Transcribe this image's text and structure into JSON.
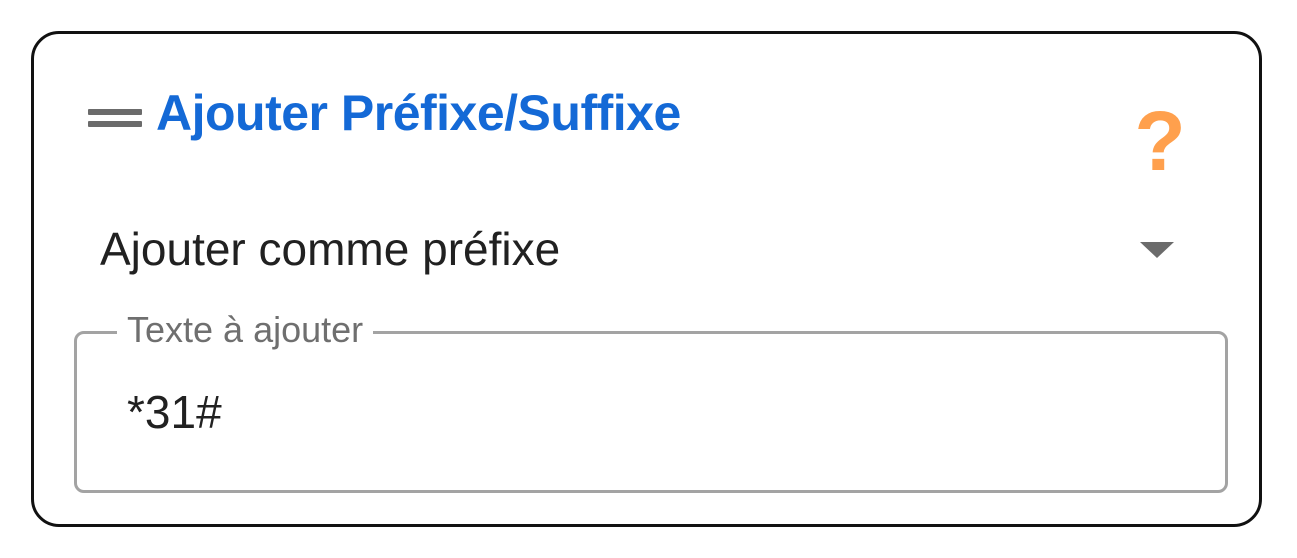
{
  "card": {
    "title": "Ajouter Préfixe/Suffixe",
    "drag_icon": "drag-handle-icon",
    "help_icon": "help-icon",
    "help_glyph": "?"
  },
  "mode_select": {
    "value": "Ajouter comme préfixe",
    "icon": "dropdown-arrow-icon"
  },
  "text_field": {
    "label": "Texte à ajouter",
    "value": "*31#"
  },
  "colors": {
    "title": "#1469d6",
    "help": "#ffa04d",
    "border": "#111111",
    "field_border": "#a3a3a3"
  }
}
